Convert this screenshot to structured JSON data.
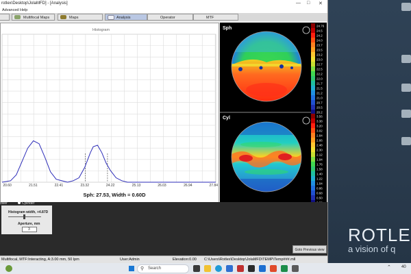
{
  "window": {
    "title": "rotlex\\Desktop\\JolaMFD] - [Analysis]",
    "menu": [
      "Advanced",
      "Help"
    ]
  },
  "tabs": [
    {
      "label": "Multifocal Maps"
    },
    {
      "label": "Maps"
    },
    {
      "label": "Analysis"
    },
    {
      "label": "Operator"
    },
    {
      "label": "MTF"
    }
  ],
  "histogram": {
    "title": "Histogram",
    "readout": "Sph: 27.53,   Width = 0.60D",
    "x_ticks": [
      "20.60",
      "21.51",
      "22.41",
      "23.32",
      "24.22",
      "25.13",
      "26.03",
      "26.94",
      "27.84"
    ]
  },
  "chart_data": {
    "type": "line",
    "title": "Histogram",
    "xlabel": "",
    "ylabel": "",
    "x_ticks": [
      20.6,
      21.51,
      22.41,
      23.32,
      24.22,
      25.13,
      26.03,
      26.94,
      27.84
    ],
    "xlim": [
      20.4,
      27.9
    ],
    "ylim": [
      0,
      1
    ],
    "grid": true,
    "series": [
      {
        "x": [
          20.4,
          20.7,
          20.9,
          21.1,
          21.3,
          21.5,
          21.7,
          21.9,
          22.1,
          22.3,
          22.5,
          22.7,
          22.9,
          23.1,
          23.3,
          23.5,
          23.6,
          23.75,
          23.9,
          24.05,
          24.2,
          24.4,
          24.6,
          24.8,
          25.0,
          25.5,
          26.0,
          27.0,
          27.9
        ],
        "y": [
          0.0,
          0.01,
          0.05,
          0.14,
          0.23,
          0.28,
          0.26,
          0.17,
          0.07,
          0.02,
          0.01,
          0.0,
          0.01,
          0.03,
          0.1,
          0.2,
          0.24,
          0.25,
          0.2,
          0.13,
          0.08,
          0.03,
          0.01,
          0.0,
          0.0,
          0.0,
          0.0,
          0.0,
          0.0
        ]
      }
    ],
    "markers": [
      23.32,
      24.1
    ]
  },
  "maps": {
    "sph_label": "Sph",
    "cyl_label": "Cyl",
    "sph_scale": [
      "24.76",
      "24.5",
      "24.2",
      "24.0",
      "23.7",
      "23.5",
      "23.2",
      "23.0",
      "22.7",
      "22.5",
      "22.2",
      "22.0",
      "21.7",
      "21.5",
      "21.2",
      "21.0",
      "20.7",
      "20.5",
      "20.2"
    ],
    "cyl_scale": [
      "3.56",
      "3.38",
      "3.20",
      "3.02",
      "2.84",
      "2.66",
      "2.48",
      "2.30",
      "2.12",
      "1.94",
      "1.76",
      "1.58",
      "1.40",
      "1.22",
      "1.04",
      "0.86",
      "0.68",
      "0.50",
      "0.32"
    ]
  },
  "controls": {
    "power_label": "ower",
    "cylinder_label": "Cylinder",
    "hist_width_label": "Histogram width, +4.87D",
    "aperture_label": "Aperture, mm",
    "aperture_value": "3"
  },
  "goto_button": "Goto Previous view",
  "status": {
    "left": "Multifocal, MTF:Interacting, A:3.00 mm, 50 lpm",
    "user": "User:Admin",
    "elevation": "Elevation:0.00",
    "path": "C:\\Users\\Rotlex\\Desktop\\JolaMFD\\TEMP\\Temp###.mll"
  },
  "desktop": {
    "brand": "ROTLE",
    "brand_sub": "a vision of q"
  },
  "taskbar": {
    "search_placeholder": "Search",
    "time": "40"
  }
}
